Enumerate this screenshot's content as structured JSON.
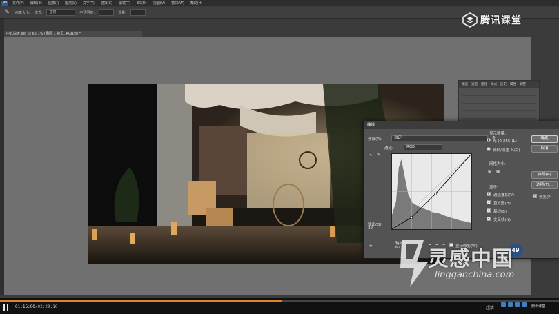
{
  "menubar": {
    "logo": "Ps",
    "items": [
      "文件(F)",
      "编辑(E)",
      "图像(I)",
      "图层(L)",
      "文字(Y)",
      "选择(S)",
      "滤镜(T)",
      "3D(D)",
      "视图(V)",
      "窗口(W)",
      "帮助(H)"
    ]
  },
  "options": {
    "size_label": "画笔大小:",
    "mode_label": "模式:",
    "mode_value": "正常",
    "opacity_label": "不透明度:",
    "flow_label": "流量:"
  },
  "document": {
    "tab_title": "中式白天.jpg @ 66.7% (图层 1 拷贝, RGB/8) *"
  },
  "layers_panel": {
    "tabs": [
      "图层",
      "通道",
      "路径",
      "样式",
      "历史",
      "属性",
      "调整"
    ]
  },
  "curves": {
    "title": "曲线",
    "preset_label": "预设(R):",
    "preset_value": "自定",
    "channel_label": "通道:",
    "channel_value": "RGB",
    "output_label": "输出(O):",
    "output_value": "39",
    "input_label": "输入(I):",
    "input_value": "62",
    "show_clipping_label": "显示修剪(W)",
    "ok_label": "确定",
    "cancel_label": "取消",
    "auto_label": "自动(A)",
    "options_label": "选项(T)...",
    "preview_label": "预览(P)",
    "display_amount_title": "显示数量:",
    "light_label": "光 (0-255)(L)",
    "pigment_label": "颜料/油墨 %(G)",
    "grid_size_title": "网格大小:",
    "show_title": "显示:",
    "show_items": [
      "通道叠加(V)",
      "直方图(H)",
      "基线(B)",
      "交叉线(N)"
    ],
    "curve_points": [
      [
        0,
        0
      ],
      [
        62,
        39
      ],
      [
        140,
        120
      ],
      [
        255,
        255
      ]
    ]
  },
  "watermarks": {
    "tencent": "腾讯课堂",
    "lg_cn": "灵感中国",
    "lg_url": "lingganchina.com"
  },
  "badge": "49",
  "player": {
    "current_time": "01:15:00",
    "total_time": "02:29:10",
    "progress": 0.504,
    "quality": "超清"
  },
  "tray": {
    "label": "腾讯课堂"
  },
  "colors": {
    "progress": "#e0842b",
    "canvas_bg": "#707070",
    "dialog_bg": "#535353"
  }
}
